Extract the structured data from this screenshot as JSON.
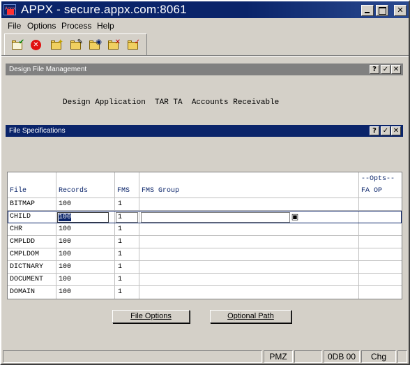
{
  "window": {
    "title": "APPX - secure.appx.com:8061",
    "icon_text": "Appx"
  },
  "menu": [
    {
      "label": "File"
    },
    {
      "label": "Options"
    },
    {
      "label": "Process"
    },
    {
      "label": "Help"
    }
  ],
  "toolbar": {
    "tools": [
      "ok-check-icon",
      "cancel-icon",
      "new-folder-icon",
      "edit-folder-icon",
      "inquire-folder-icon",
      "delete-folder-icon",
      "inspect-folder-icon"
    ]
  },
  "design_panel": {
    "title": "Design File Management",
    "line": "Design Application  TAR TA  Accounts Receivable",
    "help": "?"
  },
  "spec_panel": {
    "title": "File Specifications",
    "help": "?"
  },
  "table": {
    "opts_header": "--Opts--",
    "headers": {
      "file": "File",
      "records": "Records",
      "fms": "FMS",
      "fms_group": "FMS Group",
      "fa_op": "FA OP"
    },
    "rows": [
      {
        "file": "BITMAP",
        "records": "100",
        "fms": "1"
      },
      {
        "file": "CHILD",
        "records": "100",
        "fms": "1"
      },
      {
        "file": "CHR",
        "records": "100",
        "fms": "1"
      },
      {
        "file": "CMPLDD",
        "records": "100",
        "fms": "1"
      },
      {
        "file": "CMPLDOM",
        "records": "100",
        "fms": "1"
      },
      {
        "file": "DICTNARY",
        "records": "100",
        "fms": "1"
      },
      {
        "file": "DOCUMENT",
        "records": "100",
        "fms": "1"
      },
      {
        "file": "DOMAIN",
        "records": "100",
        "fms": "1"
      }
    ],
    "active_row": 1
  },
  "buttons": {
    "file_options": "File Options",
    "optional_path": "Optional Path"
  },
  "status": {
    "mode": "PMZ",
    "odb": "0DB 00",
    "chg": "Chg"
  }
}
